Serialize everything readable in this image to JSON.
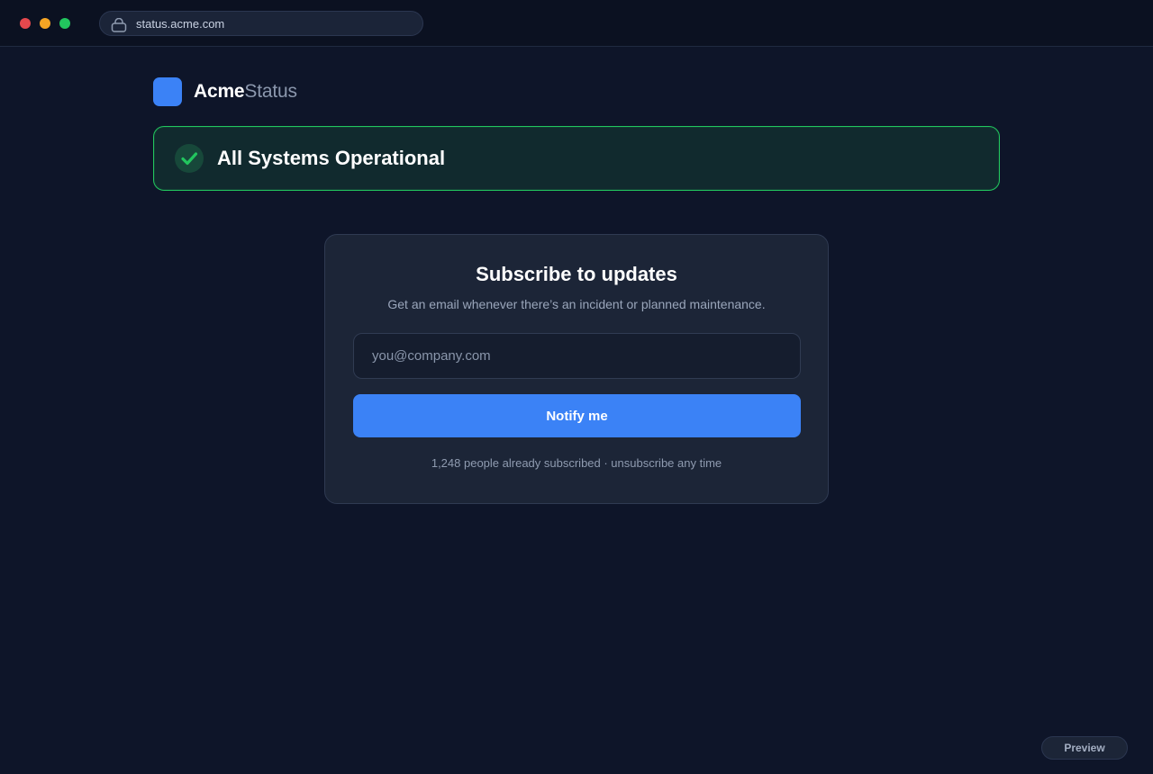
{
  "browser": {
    "url": "status.acme.com",
    "lock_icon": "lock-icon"
  },
  "brand": {
    "name_primary": "Acme",
    "name_secondary": "Status",
    "logo_color": "#3b82f6"
  },
  "status": {
    "title": "All Systems Operational",
    "icon": "checkmark-icon",
    "color": "#22c55e"
  },
  "subscribe": {
    "title": "Subscribe to updates",
    "subtitle": "Get an email whenever there’s an incident or planned maintenance.",
    "email_placeholder": "you@company.com",
    "email_value": "",
    "button_label": "Notify me",
    "footnote": "1,248 people already subscribed · unsubscribe any time"
  },
  "badge": {
    "label": "Preview"
  }
}
